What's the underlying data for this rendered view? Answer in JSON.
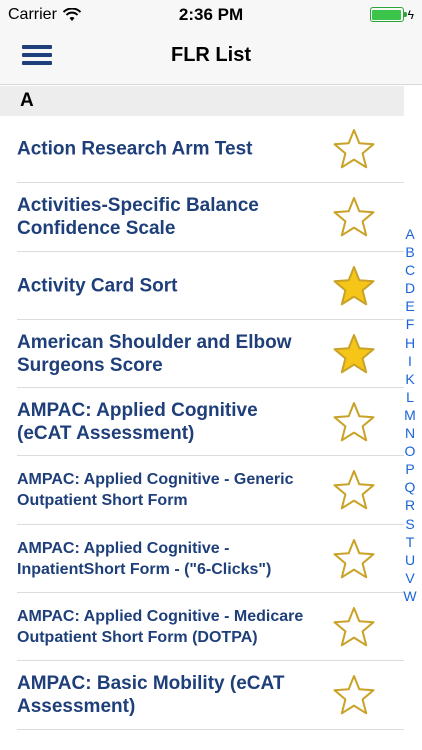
{
  "status_bar": {
    "carrier": "Carrier",
    "time": "2:36 PM",
    "battery_level": 1.0
  },
  "nav": {
    "title": "FLR List",
    "menu_icon": "hamburger-menu-icon"
  },
  "section": {
    "header": "A"
  },
  "items": [
    {
      "label": "Action Research Arm Test",
      "favorite": false
    },
    {
      "label": "Activities-Specific Balance Confidence Scale",
      "favorite": false
    },
    {
      "label": "Activity Card Sort",
      "favorite": true
    },
    {
      "label": "American Shoulder and Elbow Surgeons Score",
      "favorite": true
    },
    {
      "label": "AMPAC: Applied Cognitive (eCAT Assessment)",
      "favorite": false
    },
    {
      "label": "AMPAC: Applied Cognitive - Generic Outpatient Short Form",
      "favorite": false
    },
    {
      "label": "AMPAC: Applied Cognitive - InpatientShort Form - (\"6-Clicks\")",
      "favorite": false
    },
    {
      "label": "AMPAC: Applied Cognitive - Medicare Outpatient Short Form (DOTPA)",
      "favorite": false
    },
    {
      "label": "AMPAC: Basic Mobility (eCAT Assessment)",
      "favorite": false
    }
  ],
  "index_letters": [
    "A",
    "B",
    "C",
    "D",
    "E",
    "F",
    "H",
    "I",
    "K",
    "L",
    "M",
    "N",
    "O",
    "P",
    "Q",
    "R",
    "S",
    "T",
    "U",
    "V",
    "W"
  ],
  "colors": {
    "accent": "#1f3f7a",
    "index": "#1a64d8",
    "star_fill": "#f5c518",
    "star_outline": "#c9a227"
  }
}
